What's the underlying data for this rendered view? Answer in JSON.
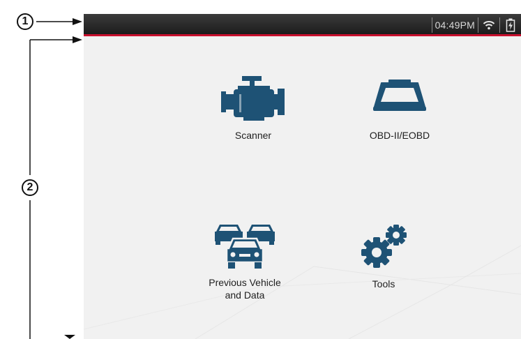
{
  "callouts": {
    "one": "1",
    "two": "2"
  },
  "statusbar": {
    "time": "04:49PM",
    "icons": [
      "wifi-icon",
      "battery-charging-icon"
    ]
  },
  "colors": {
    "accent": "#c8102e",
    "icon": "#1e5275",
    "statusbar": "#2a2a2a",
    "background": "#f1f1f1"
  },
  "apps": [
    {
      "label": "Scanner",
      "icon": "engine-icon"
    },
    {
      "label": "OBD-II/EOBD",
      "icon": "obd-connector-icon"
    },
    {
      "label": "Previous Vehicle\nand Data",
      "icon": "vehicles-icon"
    },
    {
      "label": "Tools",
      "icon": "gears-icon"
    }
  ]
}
